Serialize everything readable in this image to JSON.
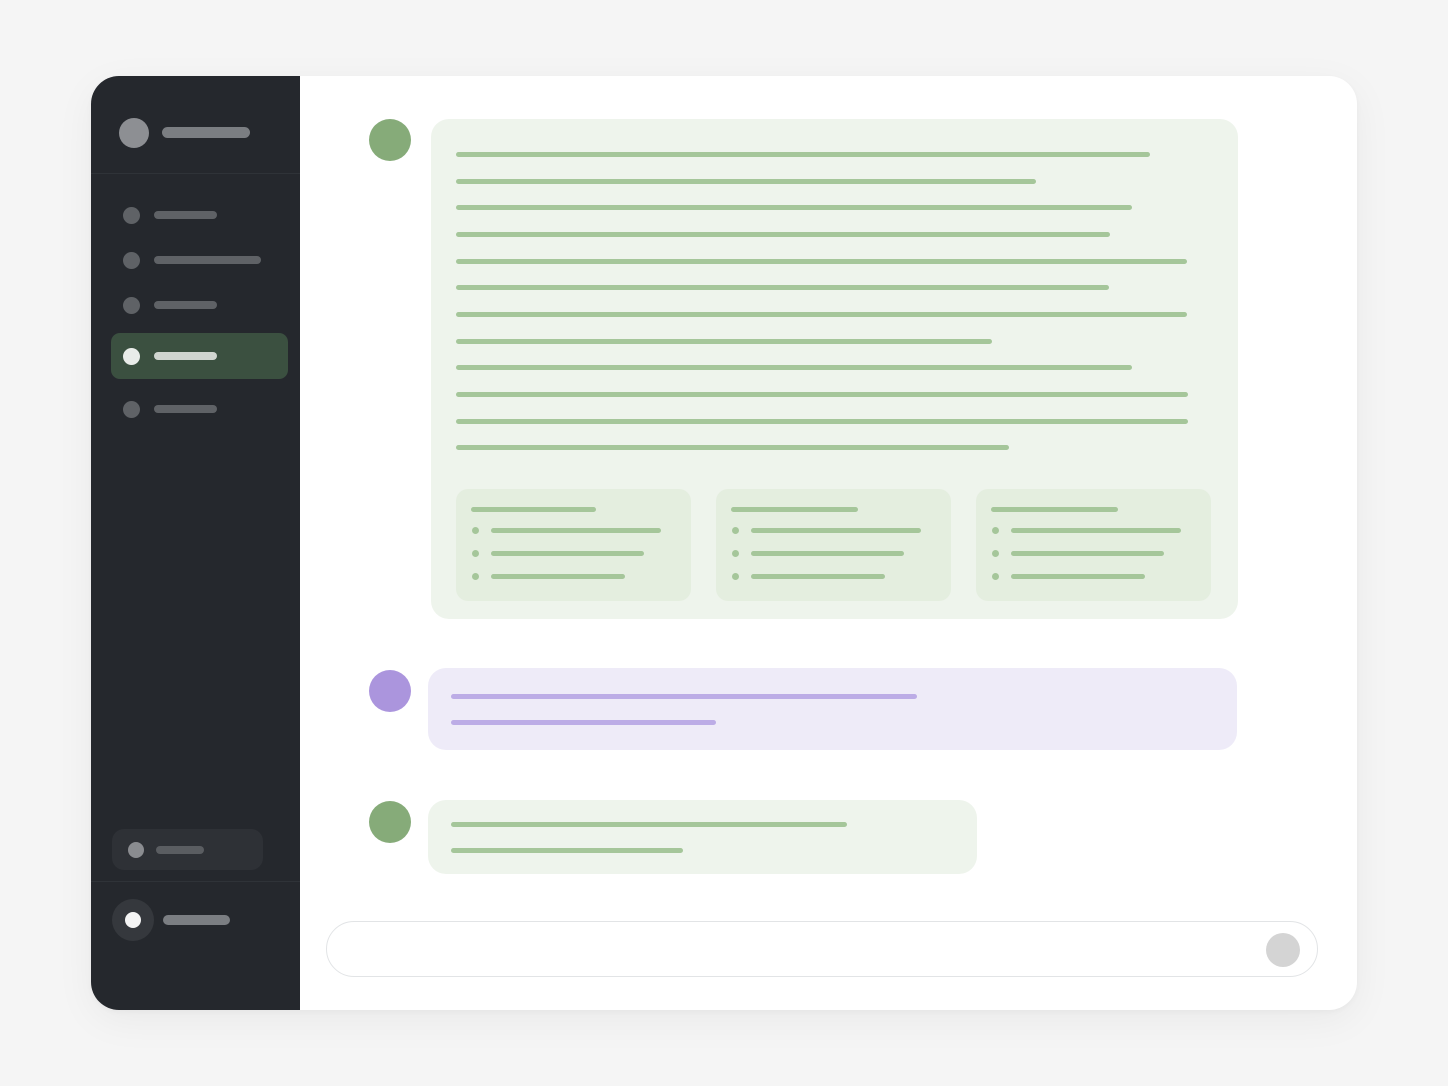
{
  "app": {
    "window_title": ""
  },
  "colors": {
    "sidebar_bg": "#25282d",
    "active_nav": "#3b5040",
    "assistant_accent": "#86ab79",
    "user_accent": "#ab95dd",
    "assistant_bubble": "#eef4ec",
    "user_bubble": "#eeebf8"
  },
  "sidebar": {
    "logo_icon": "app-logo-icon",
    "items": [
      {
        "label": "",
        "active": false
      },
      {
        "label": "",
        "active": false
      },
      {
        "label": "",
        "active": false
      },
      {
        "label": "",
        "active": true
      },
      {
        "label": "",
        "active": false
      }
    ],
    "footer_button": {
      "label": "",
      "icon": "circle-icon"
    },
    "user": {
      "name": "",
      "icon": "user-avatar-icon"
    }
  },
  "conversation": {
    "messages": [
      {
        "role": "assistant",
        "text": "",
        "cards": [
          {
            "title": "",
            "items": [
              "",
              "",
              ""
            ]
          },
          {
            "title": "",
            "items": [
              "",
              "",
              ""
            ]
          },
          {
            "title": "",
            "items": [
              "",
              "",
              ""
            ]
          }
        ]
      },
      {
        "role": "user",
        "text": ""
      },
      {
        "role": "assistant",
        "text": ""
      }
    ]
  },
  "composer": {
    "placeholder": "",
    "value": "",
    "send_icon": "send-icon"
  }
}
